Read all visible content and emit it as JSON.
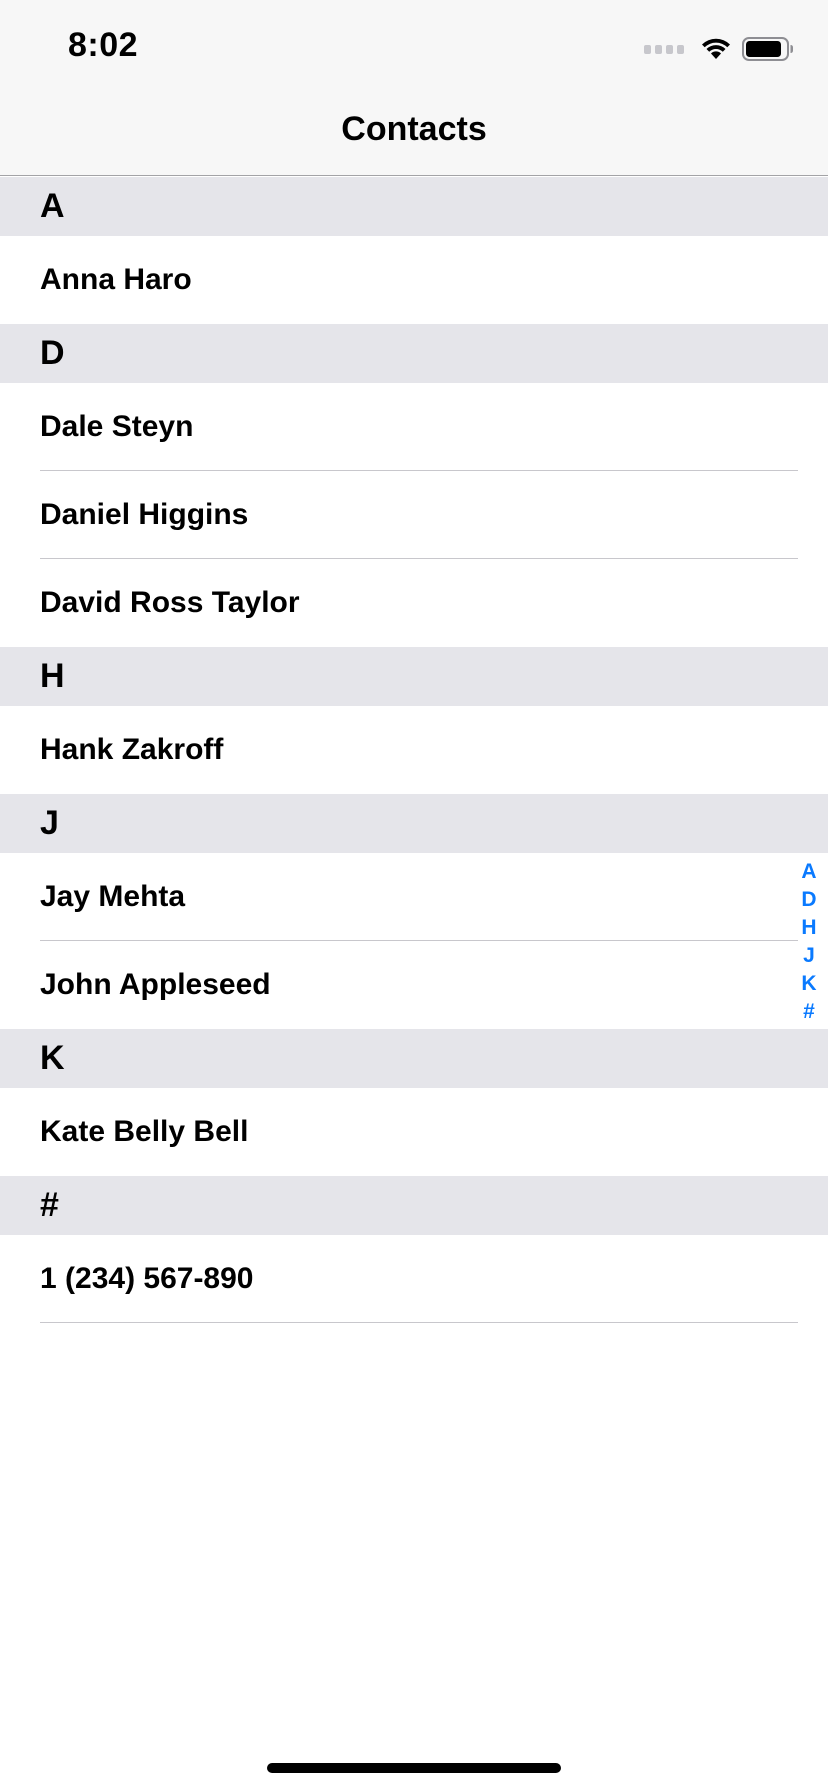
{
  "status_bar": {
    "time": "8:02"
  },
  "nav": {
    "title": "Contacts"
  },
  "sections": [
    {
      "letter": "A",
      "contacts": [
        "Anna Haro"
      ]
    },
    {
      "letter": "D",
      "contacts": [
        "Dale Steyn",
        "Daniel Higgins",
        "David Ross Taylor"
      ]
    },
    {
      "letter": "H",
      "contacts": [
        "Hank Zakroff"
      ]
    },
    {
      "letter": "J",
      "contacts": [
        "Jay Mehta",
        "John Appleseed"
      ]
    },
    {
      "letter": "K",
      "contacts": [
        "Kate Belly Bell"
      ]
    },
    {
      "letter": "#",
      "contacts": [
        "1 (234) 567-890"
      ]
    }
  ],
  "index": [
    "A",
    "D",
    "H",
    "J",
    "K",
    "#"
  ],
  "colors": {
    "accent": "#0a7aff",
    "section_header_bg": "#e5e5ea",
    "nav_bg": "#f7f7f7"
  },
  "icons": [
    "signal-icon",
    "wifi-icon",
    "battery-icon"
  ]
}
